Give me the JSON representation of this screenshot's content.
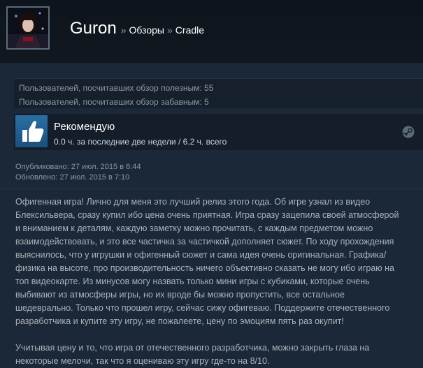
{
  "header": {
    "user_name": "Guron",
    "separator": "»",
    "breadcrumb_reviews": "Обзоры",
    "breadcrumb_game": "Cradle"
  },
  "votes": {
    "helpful": "Пользователей, посчитавших обзор полезным: 55",
    "funny": "Пользователей, посчитавших обзор забавным: 5"
  },
  "recommendation": {
    "title": "Рекомендую",
    "hours": "0.0 ч. за последние две недели / 6.2 ч. всего",
    "thumb_icon": "thumbs-up-icon",
    "platform_icon": "steam-icon"
  },
  "dates": {
    "published": "Опубликовано: 27 июл. 2015 в 6:44",
    "updated": "Обновлено: 27 июл. 2015 в 7:10"
  },
  "review": {
    "lines": [
      "Офигенная игра! Лично для меня это лучший релиз этого года. Об игре узнал из видео",
      "Блексильвера, сразу купил ибо цена очень приятная. Игра сразу зацепила своей атмосферой",
      "и вниманием к деталям, каждую заметку можно прочитать, с каждым предметом можно",
      "взаимодействовать, и это все частичка за частичкой дополняет сюжет. По ходу прохождения",
      "выяснилось, что у игрушки и офигенный сюжет и сама идея очень оригинальная. Графика/",
      "физика на высоте, про производительность ничего объективно сказать не могу ибо играю на",
      "топ видеокарте. Из минусов могу назвать только мини игры с кубиками, которые очень",
      "выбивают из атмосферы игры, но их вроде бы можно пропустить, все остальное",
      "шедеврально. Только что прошел игру, сейчас сижу офигеваю. Поддержите отечественного",
      "разработчика и купите эту игру, не пожалеете, цену по эмоциям пять раз окупит!",
      "",
      "Учитывая цену и то, что игра от отечественного разработчика, можно закрыть глаза на",
      "некоторые мелочи, так что я оцениваю эту игру где-то на 8/10."
    ]
  },
  "colors": {
    "background": "#1b2838",
    "header_bg": "#0e141b",
    "accent_blue": "#2a6fa3",
    "text_muted": "#8f98a0",
    "text_body": "#acb2b8"
  }
}
